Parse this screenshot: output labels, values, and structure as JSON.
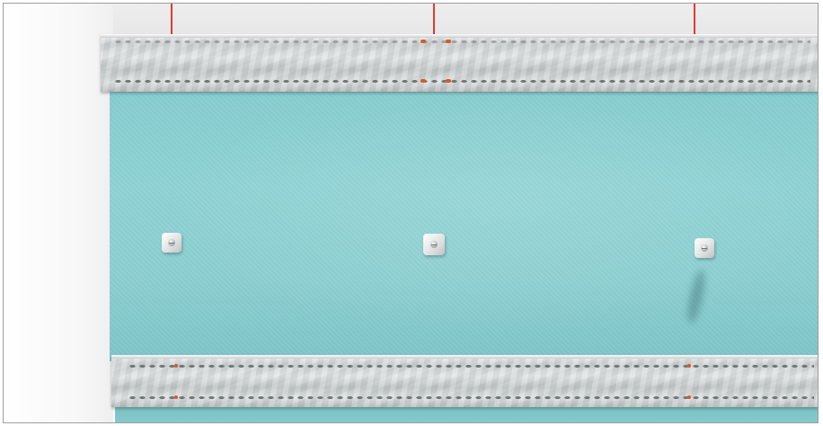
{
  "scene": {
    "subject": "metal-profile-rails-on-plasterboard",
    "colors": {
      "background": "#fbfbfb",
      "frame_border": "#9e9e9e",
      "wall": "#eeeeee",
      "plasterboard": "#8ccfd1",
      "rail_metal": "#cfd3d4",
      "laser_line": "#e23b2e",
      "fixing_marks": "#d85a22",
      "washer": "#e2e4e4"
    },
    "laser_lines": 3,
    "rails": 2,
    "screw_fixings": 3
  }
}
